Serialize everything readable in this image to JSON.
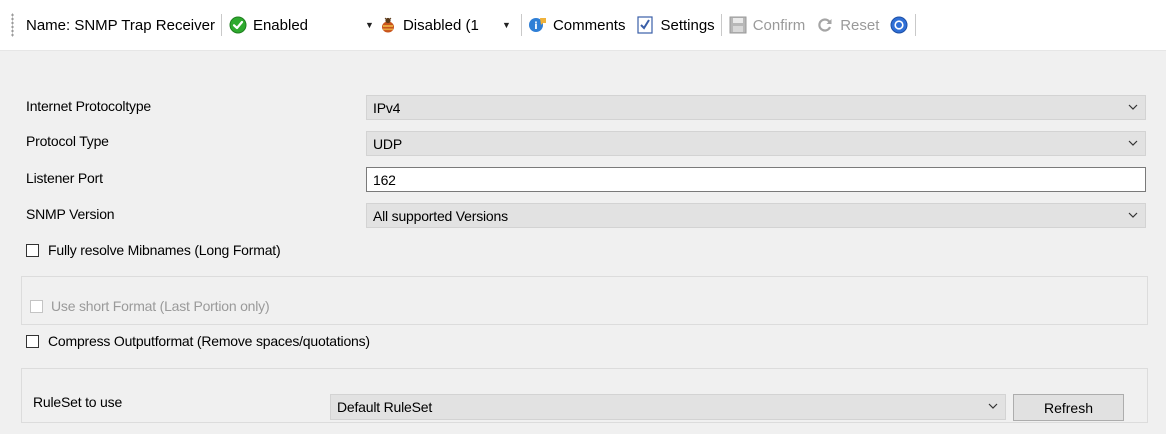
{
  "toolbar": {
    "name_label": "Name: SNMP Trap Receiver",
    "enabled_value": "Enabled",
    "disabled_value": "Disabled (1",
    "comments_label": "Comments",
    "settings_label": "Settings",
    "confirm_label": "Confirm",
    "reset_label": "Reset"
  },
  "form": {
    "protocol_label": "Internet Protocoltype",
    "protocol_value": "IPv4",
    "protocol_type_label": "Protocol Type",
    "protocol_type_value": "UDP",
    "port_label": "Listener Port",
    "port_value": "162",
    "snmp_version_label": "SNMP Version",
    "snmp_version_value": "All supported Versions",
    "fully_resolve_label": "Fully resolve Mibnames (Long Format)",
    "fully_resolve_checked": false,
    "short_format_label": "Use short Format (Last Portion only)",
    "short_format_checked": false,
    "compress_label": "Compress Outputformat (Remove spaces/quotations)",
    "compress_checked": false,
    "ruleset_label": "RuleSet to use",
    "ruleset_value": "Default RuleSet",
    "refresh_label": "Refresh"
  },
  "colors": {
    "enabled_green": "#2eaa2e",
    "help_blue": "#2f6fd6",
    "disabled_text": "#9a9a9a"
  }
}
